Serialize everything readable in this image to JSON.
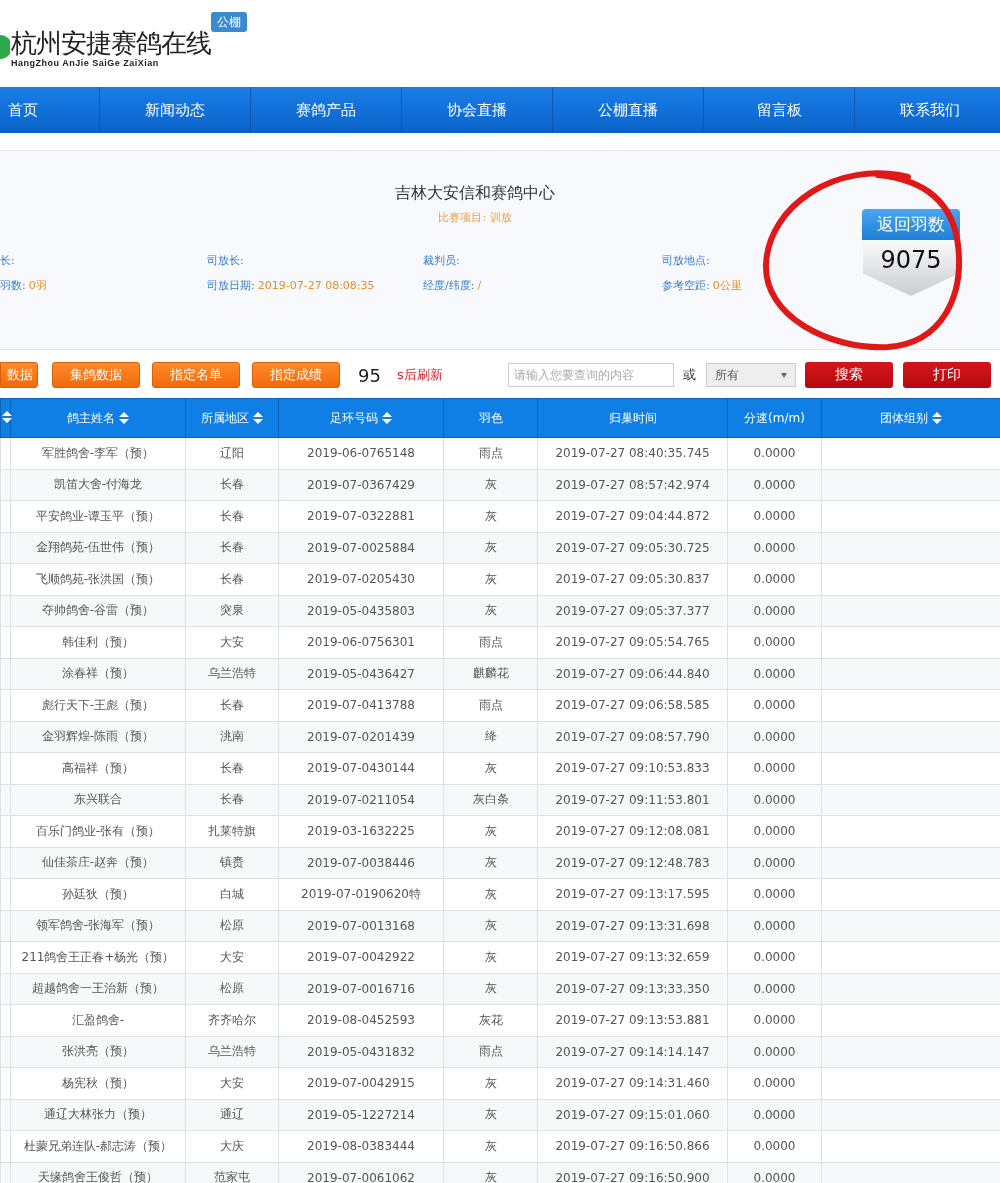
{
  "logo": {
    "title": "杭州安捷赛鸽在线",
    "subtitle": "HangZhou AnJie SaiGe ZaiXian",
    "badge": "公棚"
  },
  "nav": [
    {
      "label": "首页"
    },
    {
      "label": "新闻动态"
    },
    {
      "label": "赛鸽产品"
    },
    {
      "label": "协会直播"
    },
    {
      "label": "公棚直播"
    },
    {
      "label": "留言板"
    },
    {
      "label": "联系我们"
    }
  ],
  "race": {
    "title": "吉林大安信和赛鸽中心",
    "subtitle": "比赛项目: 训放",
    "fields": [
      {
        "label": "长:"
      },
      {
        "label": "司放长:"
      },
      {
        "label": "裁判员:"
      },
      {
        "label": "司放地点:"
      },
      {
        "label": "羽数:",
        "value": "0羽"
      },
      {
        "label": "司放日期:",
        "value": "2019-07-27 08:08:35"
      },
      {
        "label": "经度/纬度:",
        "value": "/"
      },
      {
        "label": "参考空距:",
        "value": "0公里"
      }
    ],
    "returned": {
      "label": "返回羽数",
      "count": "9075"
    }
  },
  "toolbar": {
    "buttons": [
      "数据",
      "集鸽数据",
      "指定名单",
      "指定成绩"
    ],
    "countdown": "95",
    "countdown_label": "s后刷新",
    "search": {
      "placeholder": "请输入您要查询的内容"
    },
    "or": "或",
    "filter": "所有",
    "search_button": "搜索",
    "print_button": "打印"
  },
  "table": {
    "columns": [
      {
        "sortable": true
      },
      {
        "label": "鸽主姓名",
        "sortable": true
      },
      {
        "label": "所属地区",
        "sortable": true
      },
      {
        "label": "足环号码",
        "sortable": true
      },
      {
        "label": "羽色",
        "sortable": false
      },
      {
        "label": "归巢时间",
        "sortable": false
      },
      {
        "label": "分速(m/m)",
        "sortable": false
      },
      {
        "label": "团体组别",
        "sortable": true
      }
    ],
    "rows": [
      [
        "",
        "军胜鸽舍-李军（预）",
        "辽阳",
        "2019-06-0765148",
        "雨点",
        "2019-07-27 08:40:35.745",
        "0.0000",
        ""
      ],
      [
        "",
        "凯笛大舍-付海龙",
        "长春",
        "2019-07-0367429",
        "灰",
        "2019-07-27 08:57:42.974",
        "0.0000",
        ""
      ],
      [
        "",
        "平安鸽业-谭玉平（预）",
        "长春",
        "2019-07-0322881",
        "灰",
        "2019-07-27 09:04:44.872",
        "0.0000",
        ""
      ],
      [
        "",
        "金翔鸽苑-伍世伟（预）",
        "长春",
        "2019-07-0025884",
        "灰",
        "2019-07-27 09:05:30.725",
        "0.0000",
        ""
      ],
      [
        "",
        "飞顺鸽苑-张洪国（预）",
        "长春",
        "2019-07-0205430",
        "灰",
        "2019-07-27 09:05:30.837",
        "0.0000",
        ""
      ],
      [
        "",
        "夺帅鸽舍-谷雷（预）",
        "突泉",
        "2019-05-0435803",
        "灰",
        "2019-07-27 09:05:37.377",
        "0.0000",
        ""
      ],
      [
        "",
        "韩佳利（预）",
        "大安",
        "2019-06-0756301",
        "雨点",
        "2019-07-27 09:05:54.765",
        "0.0000",
        ""
      ],
      [
        "",
        "涂春祥（预）",
        "乌兰浩特",
        "2019-05-0436427",
        "麒麟花",
        "2019-07-27 09:06:44.840",
        "0.0000",
        ""
      ],
      [
        "",
        "彪行天下-王彪（预）",
        "长春",
        "2019-07-0413788",
        "雨点",
        "2019-07-27 09:06:58.585",
        "0.0000",
        ""
      ],
      [
        "",
        "金羽辉煌-陈雨（预）",
        "洮南",
        "2019-07-0201439",
        "绛",
        "2019-07-27 09:08:57.790",
        "0.0000",
        ""
      ],
      [
        "",
        "高福祥（预）",
        "长春",
        "2019-07-0430144",
        "灰",
        "2019-07-27 09:10:53.833",
        "0.0000",
        ""
      ],
      [
        "",
        "东兴联合",
        "长春",
        "2019-07-0211054",
        "灰白条",
        "2019-07-27 09:11:53.801",
        "0.0000",
        ""
      ],
      [
        "",
        "百乐门鸽业-张有（预）",
        "扎莱特旗",
        "2019-03-1632225",
        "灰",
        "2019-07-27 09:12:08.081",
        "0.0000",
        ""
      ],
      [
        "",
        "仙佳茶庄-赵奔（预）",
        "镇赉",
        "2019-07-0038446",
        "灰",
        "2019-07-27 09:12:48.783",
        "0.0000",
        ""
      ],
      [
        "",
        "孙廷狄（预）",
        "白城",
        "2019-07-0190620特",
        "灰",
        "2019-07-27 09:13:17.595",
        "0.0000",
        ""
      ],
      [
        "",
        "领军鸽舍-张海军（预）",
        "松原",
        "2019-07-0013168",
        "灰",
        "2019-07-27 09:13:31.698",
        "0.0000",
        ""
      ],
      [
        "",
        "211鸽舍王正春+杨光（预）",
        "大安",
        "2019-07-0042922",
        "灰",
        "2019-07-27 09:13:32.659",
        "0.0000",
        ""
      ],
      [
        "",
        "超越鸽舍一王治新（预）",
        "松原",
        "2019-07-0016716",
        "灰",
        "2019-07-27 09:13:33.350",
        "0.0000",
        ""
      ],
      [
        "",
        "汇盈鸽舍-",
        "齐齐哈尔",
        "2019-08-0452593",
        "灰花",
        "2019-07-27 09:13:53.881",
        "0.0000",
        ""
      ],
      [
        "",
        "张洪亮（预）",
        "乌兰浩特",
        "2019-05-0431832",
        "雨点",
        "2019-07-27 09:14:14.147",
        "0.0000",
        ""
      ],
      [
        "",
        "杨宪秋（预）",
        "大安",
        "2019-07-0042915",
        "灰",
        "2019-07-27 09:14:31.460",
        "0.0000",
        ""
      ],
      [
        "",
        "通辽大林张力（预）",
        "通辽",
        "2019-05-1227214",
        "灰",
        "2019-07-27 09:15:01.060",
        "0.0000",
        ""
      ],
      [
        "",
        "杜蒙兄弟连队-郝志涛（预）",
        "大庆",
        "2019-08-0383444",
        "灰",
        "2019-07-27 09:16:50.866",
        "0.0000",
        ""
      ],
      [
        "",
        "天缘鸽舍王俊哲（预）",
        "范家屯",
        "2019-07-0061062",
        "灰",
        "2019-07-27 09:16:50.900",
        "0.0000",
        ""
      ]
    ]
  }
}
